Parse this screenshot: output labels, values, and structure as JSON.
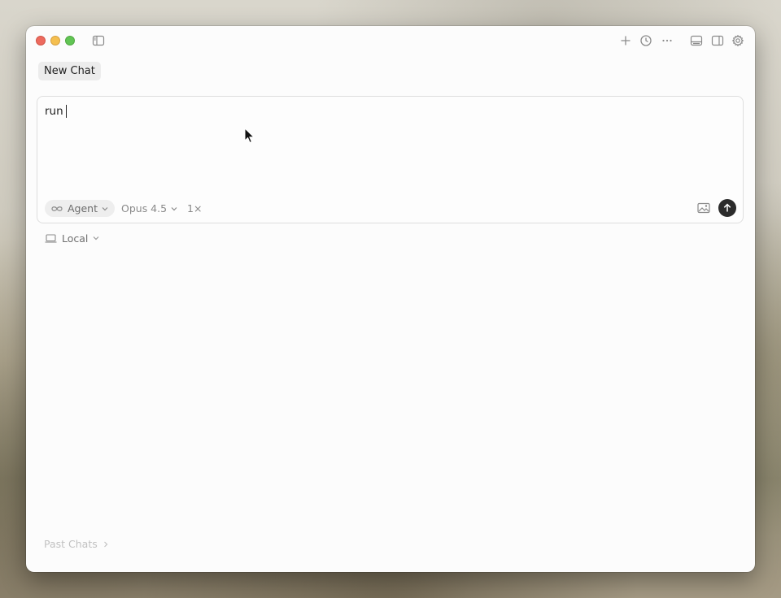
{
  "window": {
    "traffic_lights": [
      "close",
      "minimize",
      "maximize"
    ],
    "colors": {
      "close": "#ed6a5e",
      "minimize": "#f5bf4f",
      "maximize": "#61c554"
    }
  },
  "toolbar": {
    "left_icons": [
      "sidebar-toggle-icon"
    ],
    "right_icons": [
      "plus-icon",
      "history-icon",
      "more-icon",
      "panel-bottom-icon",
      "panel-right-icon",
      "gear-icon"
    ]
  },
  "tab": {
    "label": "New Chat"
  },
  "composer": {
    "text": "run",
    "mode_label": "Agent",
    "model_label": "Opus 4.5",
    "speed_label": "1×",
    "send_button_color": "#2b2b2b"
  },
  "environment": {
    "label": "Local"
  },
  "footer": {
    "past_chats_label": "Past Chats"
  }
}
